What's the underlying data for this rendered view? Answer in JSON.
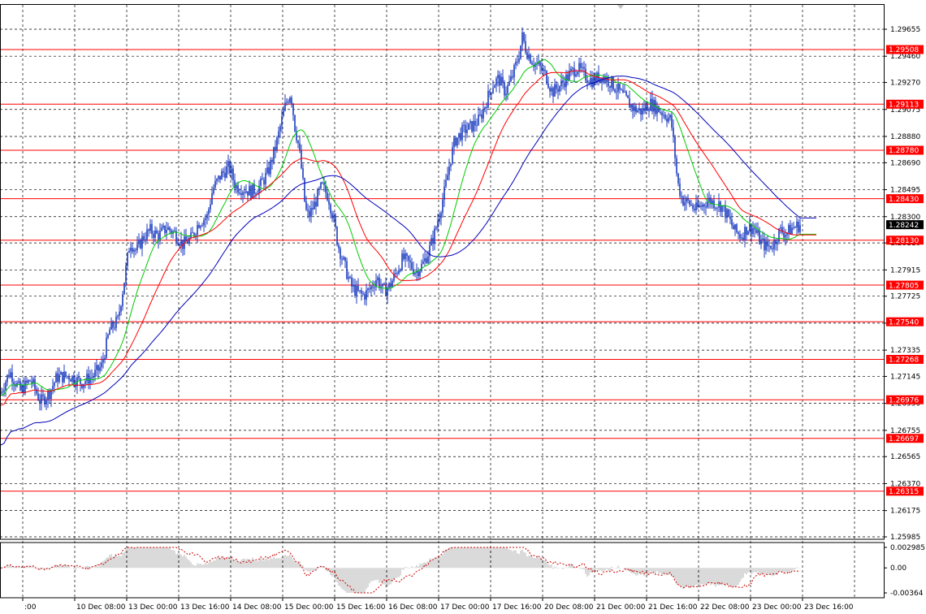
{
  "chart_data": {
    "type": "candlestick",
    "symbol": "",
    "price_axis": {
      "range": [
        1.25985,
        1.29655
      ],
      "tick_labels": [
        "1.29655",
        "1.29460",
        "1.29270",
        "1.29075",
        "1.28880",
        "1.28690",
        "1.28495",
        "1.28300",
        "1.28110",
        "1.27915",
        "1.27725",
        "1.27530",
        "1.27335",
        "1.27145",
        "1.26950",
        "1.26755",
        "1.26565",
        "1.26370",
        "1.26175",
        "1.25985"
      ]
    },
    "time_axis": {
      "tick_labels": [
        "9 Dec 16:00",
        "10 Dec 08:00",
        "13 Dec 00:00",
        "13 Dec 16:00",
        "14 Dec 08:00",
        "15 Dec 00:00",
        "15 Dec 16:00",
        "16 Dec 08:00",
        "17 Dec 00:00",
        "17 Dec 16:00",
        "20 Dec 08:00",
        "21 Dec 00:00",
        "21 Dec 16:00",
        "22 Dec 08:00",
        "23 Dec 00:00",
        "23 Dec 16:00"
      ],
      "first_label_visible": ":00"
    },
    "grid": true,
    "horizontal_levels": [
      "1.29508",
      "1.29113",
      "1.28780",
      "1.28430",
      "1.28130",
      "1.27805",
      "1.27540",
      "1.27268",
      "1.26976",
      "1.26697",
      "1.26315"
    ],
    "current_price": "1.28242",
    "price_path": [
      [
        0,
        1.2702
      ],
      [
        12,
        1.2718
      ],
      [
        25,
        1.2704
      ],
      [
        38,
        1.2712
      ],
      [
        50,
        1.2696
      ],
      [
        60,
        1.2702
      ],
      [
        70,
        1.2714
      ],
      [
        85,
        1.2715
      ],
      [
        100,
        1.271
      ],
      [
        115,
        1.2715
      ],
      [
        125,
        1.2722
      ],
      [
        135,
        1.2748
      ],
      [
        145,
        1.2755
      ],
      [
        152,
        1.278
      ],
      [
        160,
        1.2812
      ],
      [
        168,
        1.2805
      ],
      [
        176,
        1.2815
      ],
      [
        185,
        1.282
      ],
      [
        195,
        1.2816
      ],
      [
        205,
        1.2822
      ],
      [
        215,
        1.2818
      ],
      [
        225,
        1.281
      ],
      [
        235,
        1.2814
      ],
      [
        245,
        1.2826
      ],
      [
        255,
        1.283
      ],
      [
        262,
        1.285
      ],
      [
        272,
        1.286
      ],
      [
        282,
        1.2866
      ],
      [
        290,
        1.2852
      ],
      [
        300,
        1.285
      ],
      [
        310,
        1.2848
      ],
      [
        320,
        1.2852
      ],
      [
        330,
        1.2862
      ],
      [
        340,
        1.2882
      ],
      [
        347,
        1.29
      ],
      [
        352,
        1.2912
      ],
      [
        358,
        1.292
      ],
      [
        363,
        1.2895
      ],
      [
        368,
        1.288
      ],
      [
        372,
        1.286
      ],
      [
        376,
        1.2835
      ],
      [
        380,
        1.283
      ],
      [
        388,
        1.284
      ],
      [
        396,
        1.2852
      ],
      [
        404,
        1.2845
      ],
      [
        410,
        1.283
      ],
      [
        416,
        1.281
      ],
      [
        424,
        1.2795
      ],
      [
        432,
        1.278
      ],
      [
        440,
        1.2775
      ],
      [
        448,
        1.2773
      ],
      [
        456,
        1.2778
      ],
      [
        464,
        1.2786
      ],
      [
        472,
        1.2776
      ],
      [
        480,
        1.278
      ],
      [
        488,
        1.279
      ],
      [
        496,
        1.28
      ],
      [
        504,
        1.2796
      ],
      [
        512,
        1.279
      ],
      [
        520,
        1.2795
      ],
      [
        528,
        1.2805
      ],
      [
        536,
        1.282
      ],
      [
        542,
        1.2835
      ],
      [
        548,
        1.285
      ],
      [
        554,
        1.287
      ],
      [
        560,
        1.2885
      ],
      [
        570,
        1.2892
      ],
      [
        580,
        1.2895
      ],
      [
        590,
        1.29
      ],
      [
        598,
        1.2912
      ],
      [
        606,
        1.2925
      ],
      [
        614,
        1.293
      ],
      [
        622,
        1.292
      ],
      [
        630,
        1.293
      ],
      [
        638,
        1.2945
      ],
      [
        643,
        1.296
      ],
      [
        648,
        1.295
      ],
      [
        656,
        1.2942
      ],
      [
        664,
        1.2938
      ],
      [
        672,
        1.2932
      ],
      [
        680,
        1.292
      ],
      [
        690,
        1.2925
      ],
      [
        700,
        1.2932
      ],
      [
        710,
        1.2938
      ],
      [
        720,
        1.2932
      ],
      [
        730,
        1.2928
      ],
      [
        740,
        1.2932
      ],
      [
        750,
        1.2928
      ],
      [
        760,
        1.2922
      ],
      [
        770,
        1.2915
      ],
      [
        780,
        1.2908
      ],
      [
        790,
        1.2906
      ],
      [
        800,
        1.2912
      ],
      [
        810,
        1.2908
      ],
      [
        818,
        1.2904
      ],
      [
        826,
        1.29
      ],
      [
        830,
        1.288
      ],
      [
        834,
        1.2855
      ],
      [
        840,
        1.2842
      ],
      [
        848,
        1.284
      ],
      [
        856,
        1.2835
      ],
      [
        864,
        1.2838
      ],
      [
        872,
        1.2842
      ],
      [
        880,
        1.284
      ],
      [
        888,
        1.2838
      ],
      [
        896,
        1.283
      ],
      [
        904,
        1.282
      ],
      [
        912,
        1.2816
      ],
      [
        920,
        1.2822
      ],
      [
        928,
        1.2822
      ],
      [
        936,
        1.2812
      ],
      [
        944,
        1.2808
      ],
      [
        952,
        1.281
      ],
      [
        960,
        1.282
      ],
      [
        968,
        1.2818
      ],
      [
        976,
        1.2822
      ],
      [
        985,
        1.2824
      ]
    ],
    "moving_averages": [
      {
        "color": "#00cc00",
        "period": 5
      },
      {
        "color": "#ff0000",
        "period": 10
      },
      {
        "color": "#0000bb",
        "period": 20
      }
    ],
    "indicator": {
      "tick_labels": [
        "0.002985",
        "0.00",
        "-0.00364"
      ],
      "range": [
        -0.00364,
        0.002985
      ]
    },
    "colors": {
      "candle": "#1c3bbf",
      "level_line": "#ff0000",
      "level_tag": "#ff0000",
      "current_tag": "#000000",
      "grid": "#000000",
      "osc_bar": "#b4b4b4",
      "osc_signal": "#cc0000"
    }
  }
}
